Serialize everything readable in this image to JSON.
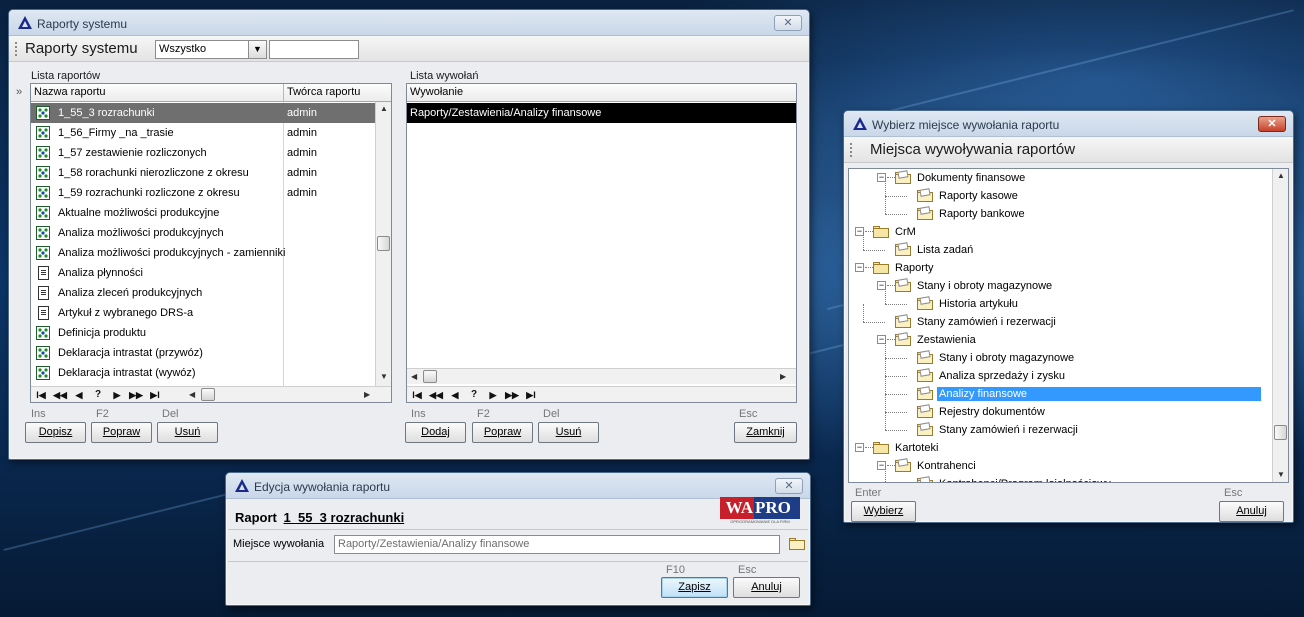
{
  "main_window": {
    "title": "Raporty systemu",
    "toolbar_title": "Raporty systemu",
    "filter_value": "Wszystko",
    "search_value": "",
    "left_group": "Lista raportów",
    "right_group": "Lista wywołań",
    "collapse_glyph": "»",
    "columns": [
      "Nazwa raportu",
      "Twórca raportu"
    ],
    "reports": [
      {
        "name": "1_55_3 rozrachunki",
        "author": "admin"
      },
      {
        "name": "1_56_Firmy _na _trasie",
        "author": "admin"
      },
      {
        "name": "1_57 zestawienie rozliczonych",
        "author": "admin"
      },
      {
        "name": "1_58 rorachunki nierozliczone z okresu",
        "author": "admin"
      },
      {
        "name": "1_59 rozrachunki rozliczone z okresu",
        "author": "admin"
      },
      {
        "name": "Aktualne możliwości produkcyjne",
        "author": ""
      },
      {
        "name": "Analiza możliwości produkcyjnych",
        "author": ""
      },
      {
        "name": "Analiza możliwości produkcyjnych - zamienniki",
        "author": ""
      },
      {
        "name": "Analiza płynności",
        "author": ""
      },
      {
        "name": "Analiza zleceń produkcyjnych",
        "author": ""
      },
      {
        "name": "Artykuł z wybranego DRS-a",
        "author": ""
      },
      {
        "name": "Definicja produktu",
        "author": ""
      },
      {
        "name": "Deklaracja intrastat (przywóz)",
        "author": ""
      },
      {
        "name": "Deklaracja intrastat (wywóz)",
        "author": ""
      }
    ],
    "calls_column": "Wywołanie",
    "calls": [
      "Raporty/Zestawienia/Analizy finansowe"
    ],
    "nav": [
      "I◀",
      "◀◀",
      "◀",
      "?",
      "▶",
      "▶▶",
      "▶I"
    ],
    "left_keys": [
      "Ins",
      "F2",
      "Del"
    ],
    "left_buttons": [
      "Dopisz",
      "Popraw",
      "Usuń"
    ],
    "right_keys": [
      "Ins",
      "F2",
      "Del",
      "Esc"
    ],
    "right_buttons": [
      "Dodaj",
      "Popraw",
      "Usuń",
      "Zamknij"
    ]
  },
  "edit_dialog": {
    "title": "Edycja wywołania raportu",
    "report_label": "Raport",
    "report_name": "1_55_3 rozrachunki",
    "logo_wa": "WA",
    "logo_pro": "PRO",
    "logo_sub": "OPROGRAMOWANIE DLA FIRM",
    "place_label": "Miejsce wywołania",
    "place_value": "Raporty/Zestawienia/Analizy finansowe",
    "keys": [
      "F10",
      "Esc"
    ],
    "buttons": [
      "Zapisz",
      "Anuluj"
    ]
  },
  "select_dialog": {
    "title": "Wybierz miejsce wywołania raportu",
    "toolbar_title": "Miejsca wywoływania raportów",
    "tree": [
      "Dokumenty finansowe",
      "Raporty kasowe",
      "Raporty bankowe",
      "CrM",
      "Lista zadań",
      "Raporty",
      "Stany i obroty magazynowe",
      "Historia artykułu",
      "Stany zamówień i rezerwacji",
      "Zestawienia",
      "Stany i obroty magazynowe",
      "Analiza sprzedaży i zysku",
      "Analizy finansowe",
      "Rejestry dokumentów",
      "Stany zamówień i rezerwacji",
      "Kartoteki",
      "Kontrahenci",
      "Kontrahenci/Program lojalnościowy"
    ],
    "keys": [
      "Enter",
      "Esc"
    ],
    "buttons": [
      "Wybierz",
      "Anuluj"
    ]
  }
}
